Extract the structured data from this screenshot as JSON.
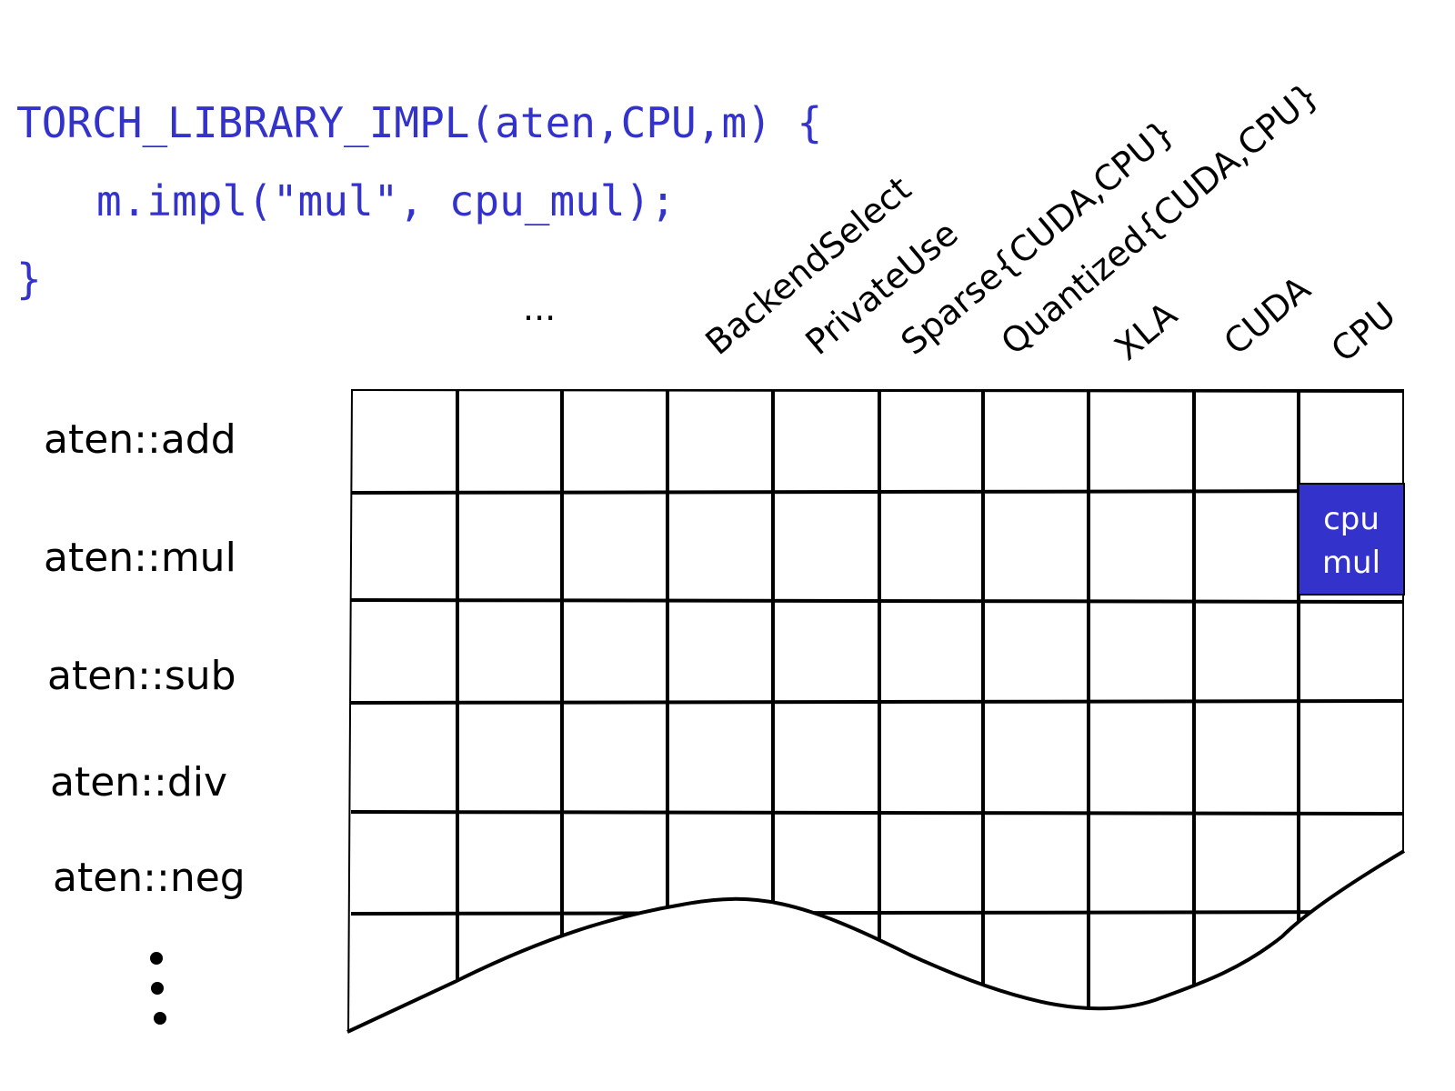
{
  "code": {
    "lines": [
      "TORCH_LIBRARY_IMPL(aten,CPU,m) {",
      "m.impl(\"mul\", cpu_mul);",
      "}"
    ],
    "color": "#3333cc"
  },
  "grid": {
    "columns_ellipsis": "...",
    "columns": [
      "BackendSelect",
      "PrivateUse",
      "Sparse{CUDA,CPU}",
      "Quantized{CUDA,CPU}",
      "XLA",
      "CUDA",
      "CPU"
    ],
    "rows": [
      "aten::add",
      "aten::mul",
      "aten::sub",
      "aten::div",
      "aten::neg"
    ],
    "rows_ellipsis": ":",
    "highlighted_cell": {
      "row": "aten::mul",
      "column": "CPU",
      "text_lines": [
        "cpu",
        "mul"
      ],
      "fill_color": "#3333cc",
      "text_color": "#ffffff"
    }
  }
}
